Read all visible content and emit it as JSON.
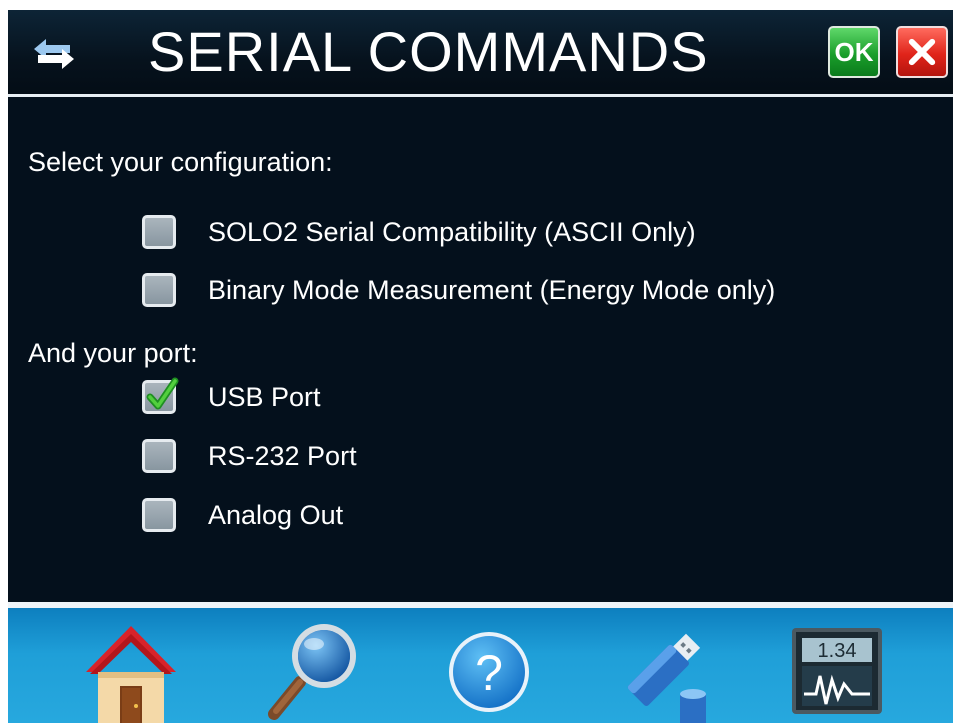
{
  "header": {
    "title": "SERIAL COMMANDS",
    "ok_label": "OK",
    "icons": {
      "swap": "swap-arrows-icon",
      "close": "close-x-icon"
    }
  },
  "config": {
    "prompt": "Select your configuration:",
    "options": [
      {
        "label": "SOLO2 Serial Compatibility (ASCII Only)",
        "checked": false
      },
      {
        "label": "Binary Mode Measurement (Energy Mode only)",
        "checked": false
      }
    ]
  },
  "port": {
    "prompt": "And your port:",
    "options": [
      {
        "label": "USB Port",
        "checked": true
      },
      {
        "label": "RS-232 Port",
        "checked": false
      },
      {
        "label": "Analog Out",
        "checked": false
      }
    ]
  },
  "toolbar": {
    "items": [
      {
        "icon": "home-icon"
      },
      {
        "icon": "search-icon"
      },
      {
        "icon": "help-icon",
        "glyph": "?"
      },
      {
        "icon": "usb-drive-icon"
      },
      {
        "icon": "meter-display-icon",
        "reading": "1.34"
      }
    ]
  },
  "colors": {
    "background": "#04101c",
    "toolbar": "#1f9fd8",
    "ok": "#1a9e2b",
    "close": "#e0241a"
  }
}
